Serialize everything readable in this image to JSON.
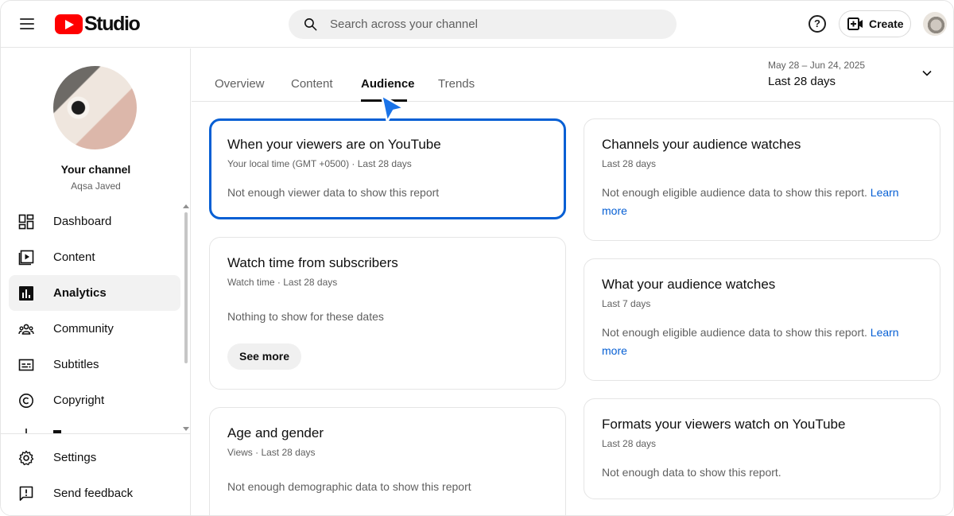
{
  "header": {
    "logo_text": "Studio",
    "search_placeholder": "Search across your channel",
    "help_symbol": "?",
    "create_label": "Create"
  },
  "sidebar": {
    "channel_label": "Your channel",
    "channel_name": "Aqsa Javed",
    "items": [
      {
        "label": "Dashboard",
        "icon": "dashboard-icon"
      },
      {
        "label": "Content",
        "icon": "content-icon"
      },
      {
        "label": "Analytics",
        "icon": "analytics-icon",
        "active": true
      },
      {
        "label": "Community",
        "icon": "community-icon"
      },
      {
        "label": "Subtitles",
        "icon": "subtitles-icon"
      },
      {
        "label": "Copyright",
        "icon": "copyright-icon"
      }
    ],
    "bottom_items": [
      {
        "label": "Settings",
        "icon": "gear-icon"
      },
      {
        "label": "Send feedback",
        "icon": "feedback-icon"
      }
    ]
  },
  "tabs": {
    "items": [
      "Overview",
      "Content",
      "Audience",
      "Trends"
    ],
    "active": "Audience"
  },
  "date_range": {
    "dates": "May 28 – Jun 24, 2025",
    "label": "Last 28 days"
  },
  "cards": {
    "viewers_on_youtube": {
      "title": "When your viewers are on YouTube",
      "subtitle": "Your local time (GMT +0500) · Last 28 days",
      "message": "Not enough viewer data to show this report"
    },
    "watch_time_subscribers": {
      "title": "Watch time from subscribers",
      "subtitle": "Watch time · Last 28 days",
      "message": "Nothing to show for these dates",
      "button": "See more"
    },
    "age_gender": {
      "title": "Age and gender",
      "subtitle": "Views · Last 28 days",
      "message": "Not enough demographic data to show this report"
    },
    "channels_audience_watches": {
      "title": "Channels your audience watches",
      "subtitle": "Last 28 days",
      "message": "Not enough eligible audience data to show this report.",
      "link": "Learn more"
    },
    "what_audience_watches": {
      "title": "What your audience watches",
      "subtitle": "Last 7 days",
      "message": "Not enough eligible audience data to show this report.",
      "link": "Learn more"
    },
    "formats_viewers_watch": {
      "title": "Formats your viewers watch on YouTube",
      "subtitle": "Last 28 days",
      "message": "Not enough data to show this report."
    }
  },
  "colors": {
    "brand_red": "#ff0000",
    "link_blue": "#065fd4",
    "selected_border": "#065fd4",
    "cursor_blue": "#1a73e8"
  }
}
